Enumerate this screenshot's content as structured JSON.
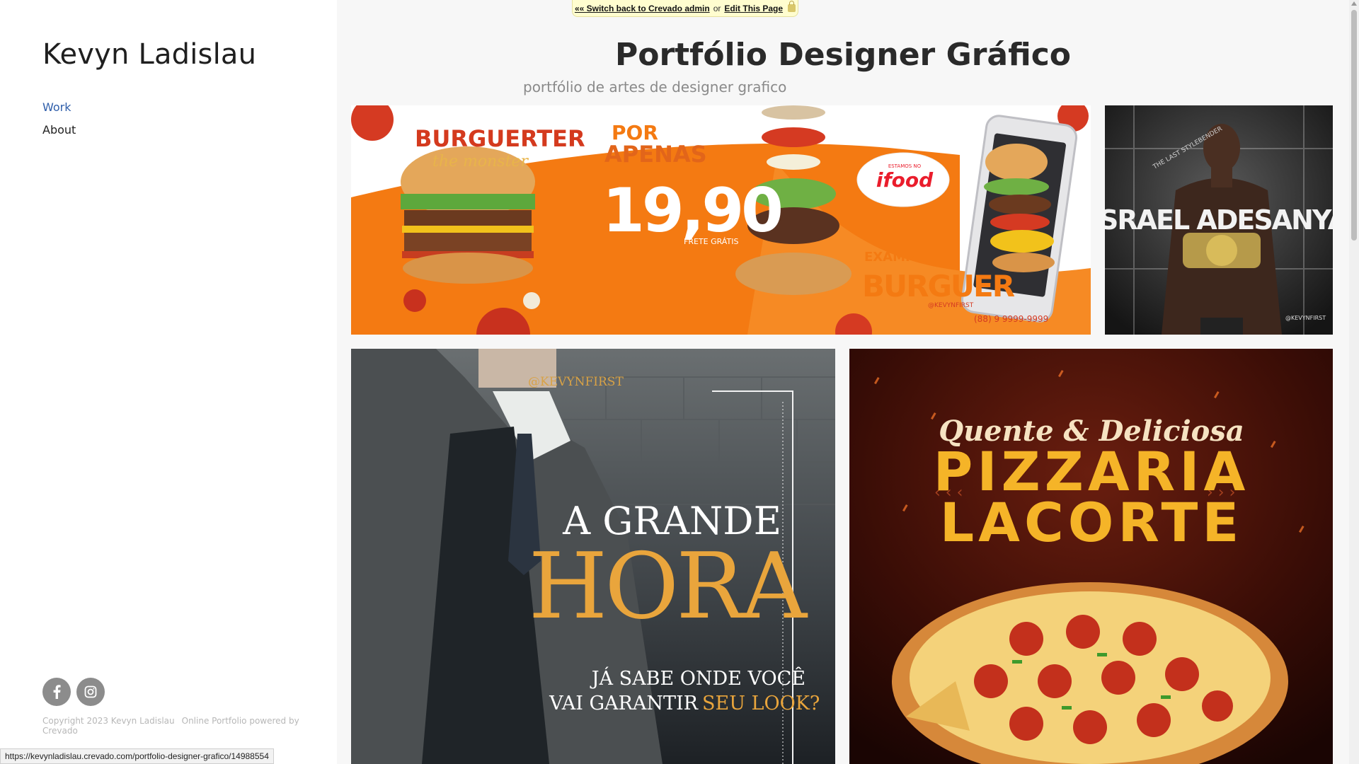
{
  "sidebar": {
    "site_title": "Kevyn Ladislau",
    "nav": [
      {
        "label": "Work",
        "active": true
      },
      {
        "label": "About",
        "active": false
      }
    ],
    "social": [
      "facebook-icon",
      "instagram-icon"
    ],
    "copyright": "Copyright 2023 Kevyn Ladislau",
    "powered_by": "Online Portfolio powered by Crevado"
  },
  "admin_bar": {
    "switch_label": "«« Switch back to Crevado admin",
    "separator": "or",
    "edit_label": "Edit This Page"
  },
  "main": {
    "title": "Portfólio Designer Gráfico",
    "subtitle": "portfólio de artes de designer grafico"
  },
  "artworks": {
    "burger": {
      "brand_line1": "BURGUERTER",
      "brand_line2": "the monster",
      "por": "POR",
      "apenas": "APENAS",
      "price": "19,90",
      "frete": "FRETE GRÁTIS",
      "estamos": "ESTAMOS NO",
      "ifood": "ifood",
      "example": "EXAMPLE",
      "burguer": "BURGUER",
      "handle": "@KEVYNFIRST",
      "phone": "(88) 9 9999-9999"
    },
    "fighter": {
      "name": "ISRAEL ADESANYA",
      "tagline": "THE LAST STYLEBENDER",
      "handle": "@KEVYNFIRST"
    },
    "suit": {
      "handle": "@KEVYNFIRST",
      "line1": "A GRANDE",
      "line2": "HORA",
      "line3": "JÁ SABE ONDE VOCÊ",
      "line4_a": "VAI GARANTIR",
      "line4_b": "SEU LOOK?"
    },
    "pizza": {
      "tagline": "Quente & Deliciosa",
      "line1": "PIZZARIA",
      "line2": "LACORTE"
    }
  },
  "status_bar": {
    "url": "https://kevynladislau.crevado.com/portfolio-designer-grafico/14988554"
  },
  "colors": {
    "accent_link": "#2f5eaa",
    "burger_orange": "#f47a12",
    "gold": "#e9a53c"
  }
}
